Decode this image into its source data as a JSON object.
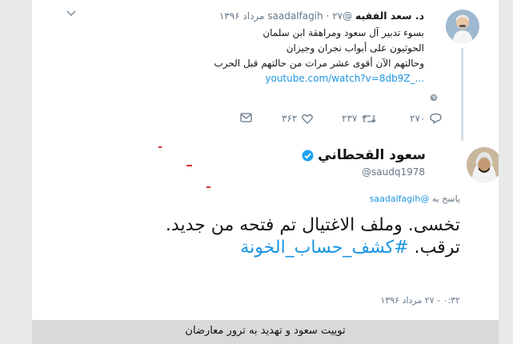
{
  "caption": "توییت سعود و تهدید به ترور معارضان",
  "tweet1": {
    "name": "د. سعد الفقيه",
    "handle": "@saadalfagih",
    "separator": "·",
    "date": "۲۷ مرداد ۱۳۹۶",
    "lines": [
      "بسوء تدبير آل سعود ومراهقة ابن سلمان",
      "الحوثيون على أبواب نجران وجيزان",
      "وحالتهم الآن أقوى عشر مرات من حالتهم قبل الحرب"
    ],
    "link": "youtube.com/watch?v=8db9Z_...",
    "reply_count": "۲۷۰",
    "retweet_count": "۲۳۷",
    "like_count": "۳۶۲"
  },
  "tweet2": {
    "name": "سعود القحطاني",
    "handle": "@saudq1978",
    "reply_prefix": "پاسخ به",
    "reply_handle": "@saadalfagih",
    "line1": "تخسى.  وملف الاغتيال تم فتحه من جديد.",
    "line2_text": "ترقب.",
    "hashtag": "#كشف_حساب_الخونة",
    "time": "۰:۳۲ - ۲۷ مرداد ۱۳۹۶"
  },
  "icons": {
    "verified": "verified-badge-icon",
    "reply": "reply-icon",
    "retweet": "retweet-icon",
    "like": "heart-icon",
    "dm": "envelope-icon",
    "globe": "globe-icon",
    "chevron": "chevron-down-icon"
  },
  "colors": {
    "link": "#1b95e0",
    "muted": "#657786",
    "text": "#14171a",
    "verified": "#1da1f2"
  }
}
